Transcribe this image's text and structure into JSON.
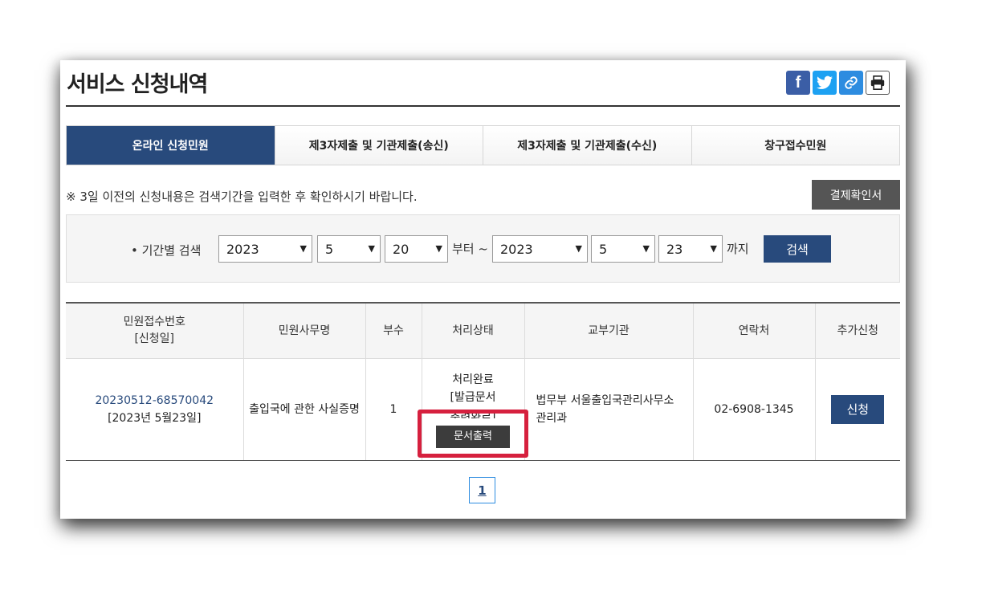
{
  "page": {
    "title": "서비스 신청내역"
  },
  "share": {
    "facebook_icon": "f",
    "twitter_icon": "🐦",
    "link_icon": "🔗",
    "print_icon": "🖶"
  },
  "tabs": [
    {
      "label": "온라인 신청민원",
      "active": true
    },
    {
      "label": "제3자제출 및 기관제출(송신)",
      "active": false
    },
    {
      "label": "제3자제출 및 기관제출(수신)",
      "active": false
    },
    {
      "label": "창구접수민원",
      "active": false
    }
  ],
  "notice": "※ 3일 이전의 신청내용은 검색기간을 입력한 후 확인하시기 바랍니다.",
  "confirm_button": "결제확인서",
  "search": {
    "label": "• 기간별 검색",
    "from_year": "2023",
    "from_month": "5",
    "from_day": "20",
    "from_text": "부터 ~",
    "to_year": "2023",
    "to_month": "5",
    "to_day": "23",
    "to_text": "까지",
    "button": "검색"
  },
  "table": {
    "headers": {
      "col1_line1": "민원접수번호",
      "col1_line2": "[신청일]",
      "col2": "민원사무명",
      "col3": "부수",
      "col4": "처리상태",
      "col5": "교부기관",
      "col6": "연락처",
      "col7": "추가신청"
    },
    "rows": [
      {
        "receipt_no": "20230512-68570042",
        "date": "[2023년 5월23일]",
        "name": "출입국에 관한 사실증명",
        "copies": "1",
        "status_line1": "처리완료",
        "status_line2": "[발급문서",
        "status_line3": "출력완료]",
        "print_button": "문서출력",
        "agency_line1": "법무부 서울출입국관리사무소",
        "agency_line2": "관리과",
        "contact": "02-6908-1345",
        "apply_button": "신청"
      }
    ]
  },
  "pagination": {
    "current": "1"
  },
  "colors": {
    "primary": "#284a7c",
    "highlight": "#d6203e"
  }
}
